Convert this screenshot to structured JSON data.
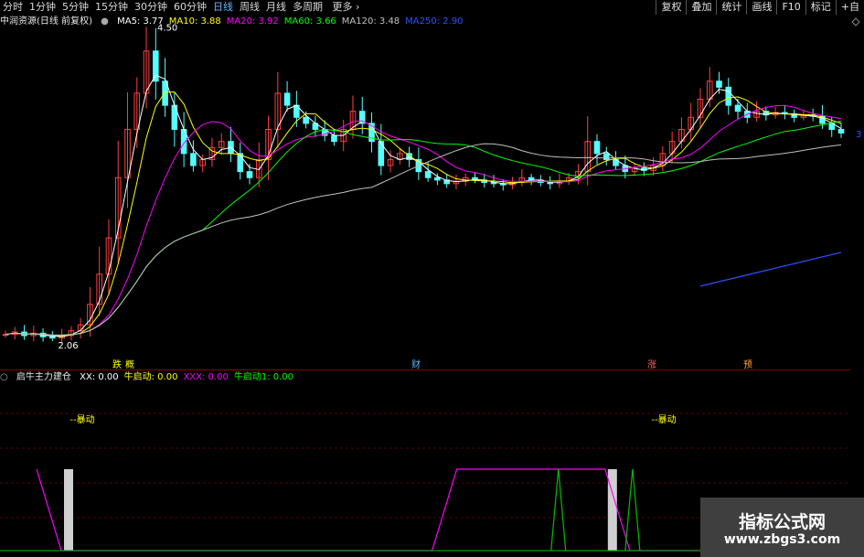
{
  "toolbar": {
    "periods": [
      "分时",
      "1分钟",
      "5分钟",
      "15分钟",
      "30分钟",
      "60分钟",
      "日线",
      "周线",
      "月线",
      "多周期"
    ],
    "selected": "日线",
    "more": "更多",
    "more_icon": "chevron-right-icon",
    "buttons": [
      "复权",
      "叠加",
      "统计",
      "画线",
      "F10",
      "标记",
      "+自"
    ]
  },
  "main_legend": {
    "title": "中润资源(日线 前复权)",
    "icon": "circle-toggle-icon",
    "items": [
      {
        "label": "MA5: 3.77",
        "color": "#ffffff"
      },
      {
        "label": "MA10: 3.88",
        "color": "#ffff00"
      },
      {
        "label": "MA20: 3.92",
        "color": "#ff00ff"
      },
      {
        "label": "MA60: 3.66",
        "color": "#00ff00"
      },
      {
        "label": "MA120: 3.48",
        "color": "#c0c0c0"
      },
      {
        "label": "MA250: 2.90",
        "color": "#3050ff"
      }
    ]
  },
  "sub_legend": {
    "title": "启牛主力建仓",
    "icon": "circle-toggle-icon",
    "items": [
      {
        "label": "XX: 0.00",
        "color": "#ffffff"
      },
      {
        "label": "牛启动: 0.00",
        "color": "#ffff00"
      },
      {
        "label": "XXX: 0.00",
        "color": "#ff00ff"
      },
      {
        "label": "牛启动1: 0.00",
        "color": "#00ff00"
      }
    ]
  },
  "watermark": {
    "line1": "指标公式网",
    "line2": "www.zbgs3.com"
  },
  "chart_data": [
    {
      "type": "candlestick",
      "title": "中润资源(日线 前复权)",
      "annotations": [
        {
          "text": "4.50",
          "kind": "high"
        },
        {
          "text": "2.06",
          "kind": "low"
        }
      ],
      "events": [
        "跌",
        "概",
        "财",
        "涨",
        "预"
      ],
      "right_axis_tick": "3",
      "up_color": "#ff4040",
      "down_color": "#54ffff",
      "price_range": [
        1.9,
        4.6
      ],
      "close": [
        2.1,
        2.12,
        2.09,
        2.11,
        2.08,
        2.07,
        2.09,
        2.13,
        2.18,
        2.35,
        2.6,
        2.9,
        3.4,
        3.8,
        4.1,
        4.45,
        4.2,
        4.0,
        3.8,
        3.6,
        3.5,
        3.55,
        3.65,
        3.7,
        3.6,
        3.45,
        3.4,
        3.55,
        3.8,
        4.1,
        4.0,
        3.9,
        3.85,
        3.8,
        3.75,
        3.7,
        3.8,
        3.95,
        3.85,
        3.7,
        3.5,
        3.55,
        3.6,
        3.55,
        3.45,
        3.4,
        3.38,
        3.35,
        3.37,
        3.4,
        3.38,
        3.36,
        3.35,
        3.34,
        3.36,
        3.4,
        3.38,
        3.36,
        3.35,
        3.37,
        3.4,
        3.45,
        3.7,
        3.6,
        3.55,
        3.5,
        3.45,
        3.48,
        3.46,
        3.5,
        3.6,
        3.7,
        3.8,
        3.9,
        4.05,
        4.2,
        4.15,
        4.0,
        3.95,
        3.9,
        3.95,
        3.92,
        3.94,
        3.93,
        3.9,
        3.92,
        3.91,
        3.85,
        3.8,
        3.77
      ]
    },
    {
      "type": "line",
      "title": "启牛主力建仓",
      "series": [
        {
          "name": "XX",
          "values": [
            1,
            0,
            0,
            0,
            0,
            0,
            0,
            0,
            0,
            0,
            0,
            0,
            0,
            0,
            0,
            0,
            0,
            0,
            0,
            0,
            0,
            0,
            1,
            0,
            0,
            0,
            0,
            0
          ]
        },
        {
          "name": "牛启动",
          "values": [
            0,
            0,
            0,
            0,
            0,
            0,
            0,
            0,
            0,
            0,
            0,
            0,
            0,
            0,
            0,
            0,
            0,
            0,
            0,
            0,
            0,
            0,
            0,
            0,
            0,
            0,
            0,
            0
          ]
        },
        {
          "name": "XXX",
          "values": [
            1,
            0,
            0,
            0,
            0,
            0,
            0,
            0,
            0,
            0,
            0,
            0,
            0,
            0,
            0,
            0,
            0,
            1,
            1,
            1,
            1,
            1,
            1,
            1,
            0,
            0,
            0,
            0
          ]
        },
        {
          "name": "牛启动1",
          "values": [
            0,
            0,
            0,
            0,
            0,
            0,
            0,
            0,
            0,
            0,
            0,
            0,
            0,
            0,
            0,
            0,
            0,
            0,
            0,
            0,
            1,
            0,
            0,
            1,
            0,
            0,
            0,
            0
          ]
        }
      ],
      "labels": [
        "--暴动",
        "--暴动"
      ]
    }
  ]
}
